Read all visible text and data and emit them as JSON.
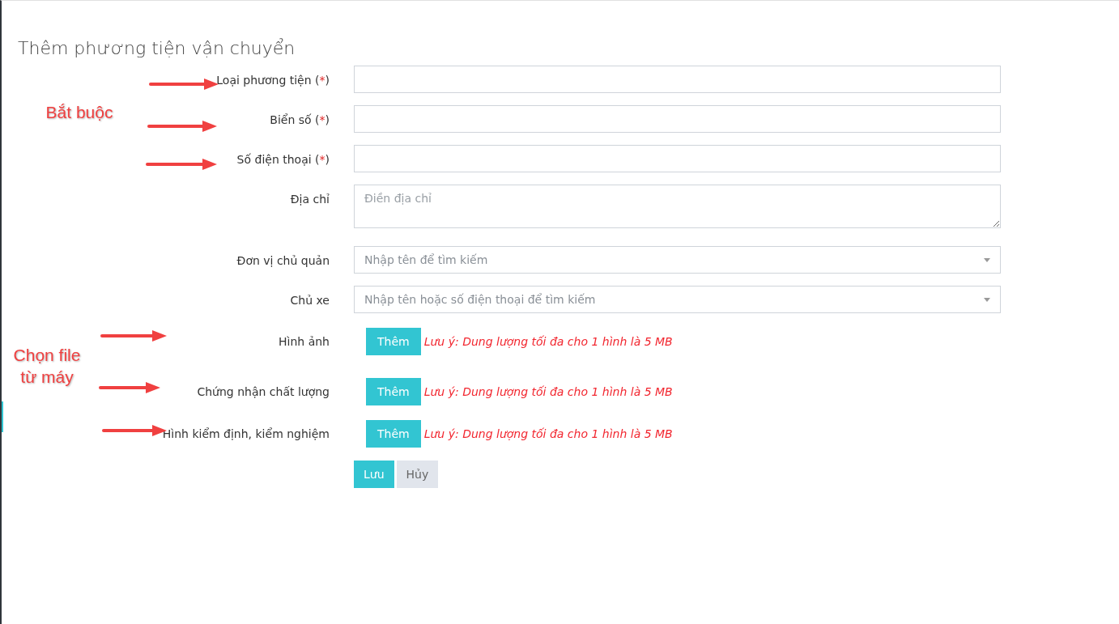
{
  "title": "Thêm phương tiện vận chuyển",
  "fields": [
    {
      "kind": "text",
      "label": "Loại phương tiện",
      "required_mark": [
        "(",
        "*",
        ")"
      ]
    },
    {
      "kind": "text",
      "label": "Biển số",
      "required_mark": [
        "(",
        "*",
        ")"
      ]
    },
    {
      "kind": "text",
      "label": "Số điện thoại",
      "required_mark": [
        "(",
        "*",
        ")"
      ]
    },
    {
      "kind": "textarea",
      "label": "Địa chỉ",
      "placeholder": "Điền địa chỉ"
    },
    {
      "kind": "select",
      "label": "Đơn vị chủ quản",
      "placeholder": "Nhập tên để tìm kiếm"
    },
    {
      "kind": "select",
      "label": "Chủ xe",
      "placeholder": "Nhập tên hoặc số điện thoại để tìm kiếm"
    },
    {
      "kind": "file",
      "label": "Hình ảnh",
      "button": "Thêm",
      "note": "Lưu ý: Dung lượng tối đa cho 1 hình là 5 MB"
    },
    {
      "kind": "file",
      "label": "Chứng nhận chất lượng",
      "button": "Thêm",
      "note": "Lưu ý: Dung lượng tối đa cho 1 hình là 5 MB"
    },
    {
      "kind": "file",
      "label": "Hình kiểm định, kiểm nghiệm",
      "button": "Thêm",
      "note": "Lưu ý: Dung lượng tối đa cho 1 hình là 5 MB"
    }
  ],
  "actions": [
    {
      "kind": "primary",
      "label": "Lưu"
    },
    {
      "kind": "secondary",
      "label": "Hủy"
    }
  ],
  "annotations": [
    {
      "text": "Bắt buộc"
    },
    {
      "text": "Chọn file từ máy"
    }
  ]
}
